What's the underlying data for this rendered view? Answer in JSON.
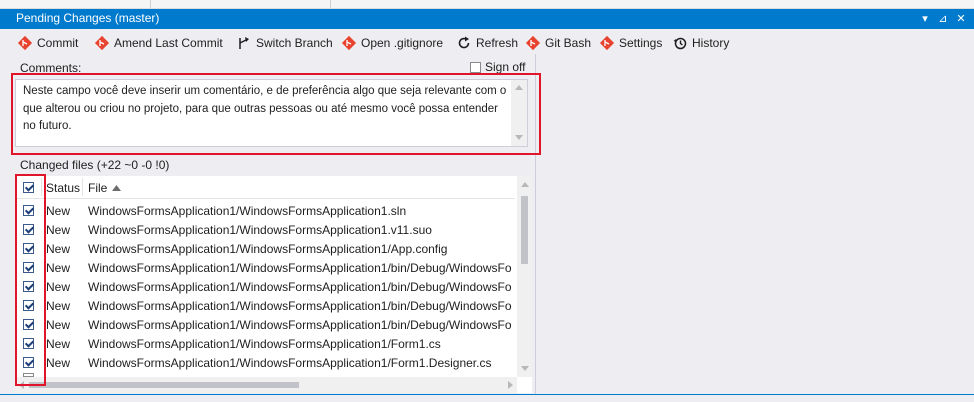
{
  "window": {
    "title": "Pending Changes (master)",
    "controls": [
      "▾",
      "⊿",
      "✕"
    ]
  },
  "toolbar": {
    "commit": "Commit",
    "amend": "Amend Last Commit",
    "switch_branch": "Switch Branch",
    "open_gitignore": "Open .gitignore",
    "refresh": "Refresh",
    "git_bash": "Git Bash",
    "settings": "Settings",
    "history": "History"
  },
  "comments": {
    "label": "Comments:",
    "sign_off_label": "Sign off",
    "sign_off_checked": false,
    "text": "Neste campo você deve inserir um comentário, e de preferência algo que seja relevante com o que alterou ou criou no projeto, para que outras pessoas ou até mesmo você possa entender no futuro."
  },
  "changed_files": {
    "label": "Changed files (+22 ~0 -0 !0)",
    "columns": {
      "status": "Status",
      "file": "File"
    },
    "sort_column": "File",
    "sort_direction": "ascending",
    "rows": [
      {
        "checked": true,
        "status": "New",
        "file": "WindowsFormsApplication1/WindowsFormsApplication1.sln"
      },
      {
        "checked": true,
        "status": "New",
        "file": "WindowsFormsApplication1/WindowsFormsApplication1.v11.suo"
      },
      {
        "checked": true,
        "status": "New",
        "file": "WindowsFormsApplication1/WindowsFormsApplication1/App.config"
      },
      {
        "checked": true,
        "status": "New",
        "file": "WindowsFormsApplication1/WindowsFormsApplication1/bin/Debug/WindowsFo"
      },
      {
        "checked": true,
        "status": "New",
        "file": "WindowsFormsApplication1/WindowsFormsApplication1/bin/Debug/WindowsFo"
      },
      {
        "checked": true,
        "status": "New",
        "file": "WindowsFormsApplication1/WindowsFormsApplication1/bin/Debug/WindowsFo"
      },
      {
        "checked": true,
        "status": "New",
        "file": "WindowsFormsApplication1/WindowsFormsApplication1/bin/Debug/WindowsFo"
      },
      {
        "checked": true,
        "status": "New",
        "file": "WindowsFormsApplication1/WindowsFormsApplication1/Form1.cs"
      },
      {
        "checked": true,
        "status": "New",
        "file": "WindowsFormsApplication1/WindowsFormsApplication1/Form1.Designer.cs"
      }
    ]
  },
  "colors": {
    "accent": "#007acc",
    "highlight_box": "#e0142a",
    "git_icon": "#e8432f"
  }
}
